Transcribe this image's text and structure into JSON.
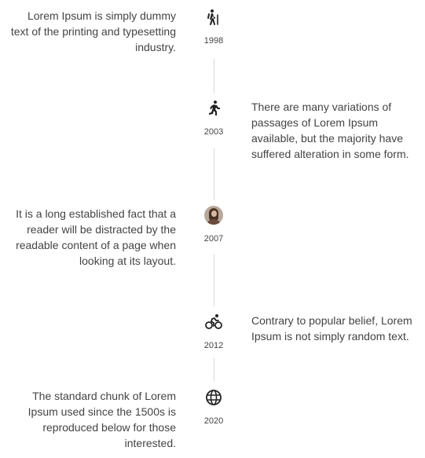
{
  "timeline": {
    "items": [
      {
        "year": "1998",
        "icon": "hiking-icon",
        "side": "left",
        "text": "Lorem Ipsum is simply dummy text of the printing and typesetting industry."
      },
      {
        "year": "2003",
        "icon": "running-icon",
        "side": "right",
        "text": "There are many variations of passages of Lorem Ipsum available, but the majority have suffered alteration in some form."
      },
      {
        "year": "2007",
        "icon": "avatar-image",
        "side": "left",
        "text": "It is a long established fact that a reader will be distracted by the readable content of a page when looking at its layout."
      },
      {
        "year": "2012",
        "icon": "bicycle-icon",
        "side": "right",
        "text": "Contrary to popular belief, Lorem Ipsum is not simply random text."
      },
      {
        "year": "2020",
        "icon": "globe-icon",
        "side": "left",
        "text": "The standard chunk of Lorem Ipsum used since the 1500s is reproduced below for those interested."
      }
    ]
  },
  "colors": {
    "text": "#444444",
    "line": "#d6d6d6",
    "icon": "#222222"
  }
}
